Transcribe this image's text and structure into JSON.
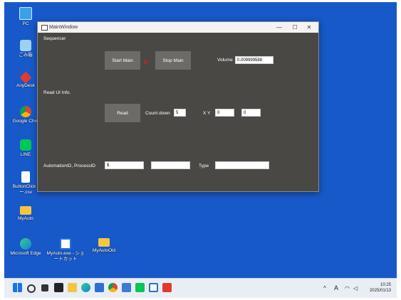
{
  "desktop": {
    "icons": [
      {
        "label": "PC"
      },
      {
        "label": "ごみ箱"
      },
      {
        "label": "AnyDesk"
      },
      {
        "label": "Google Chro"
      },
      {
        "label": "LINE"
      },
      {
        "label": "ButtonClick - ー.csv"
      },
      {
        "label": "MyAuto"
      },
      {
        "label": "Microsoft Edge"
      },
      {
        "label": "MyAuto.exe - ショートカット"
      },
      {
        "label": "MyAutoOld"
      }
    ]
  },
  "window": {
    "title": "MainWindow",
    "controls": {
      "minimize": "—",
      "maximize": "☐",
      "close": "✕"
    },
    "sequencer_label": "Sequencer",
    "start_main_label": "Start Main",
    "stop_main_label": "Stop Main",
    "volume_label": "Volume",
    "volume_value": "0.009999588",
    "read_ui_label": "Read UI Info.",
    "read_label": "Read",
    "countdown_label": "Count down",
    "countdown_value": "5",
    "xy_label": "X Y",
    "x_value": "0",
    "y_value": "0",
    "automation_label": "AutomationID, ProcessID",
    "automation_value": "$",
    "process_value": "",
    "type_label": "Type",
    "type_value": ""
  },
  "taskbar": {
    "tray_chevron": "^",
    "ime": "A",
    "time": "10:25",
    "date": "2025/01/13"
  },
  "colors": {
    "desktop_bg": "#1759c9",
    "window_bg": "#4a4845",
    "button_bg": "#6c6b68",
    "indicator": "#e02020"
  }
}
